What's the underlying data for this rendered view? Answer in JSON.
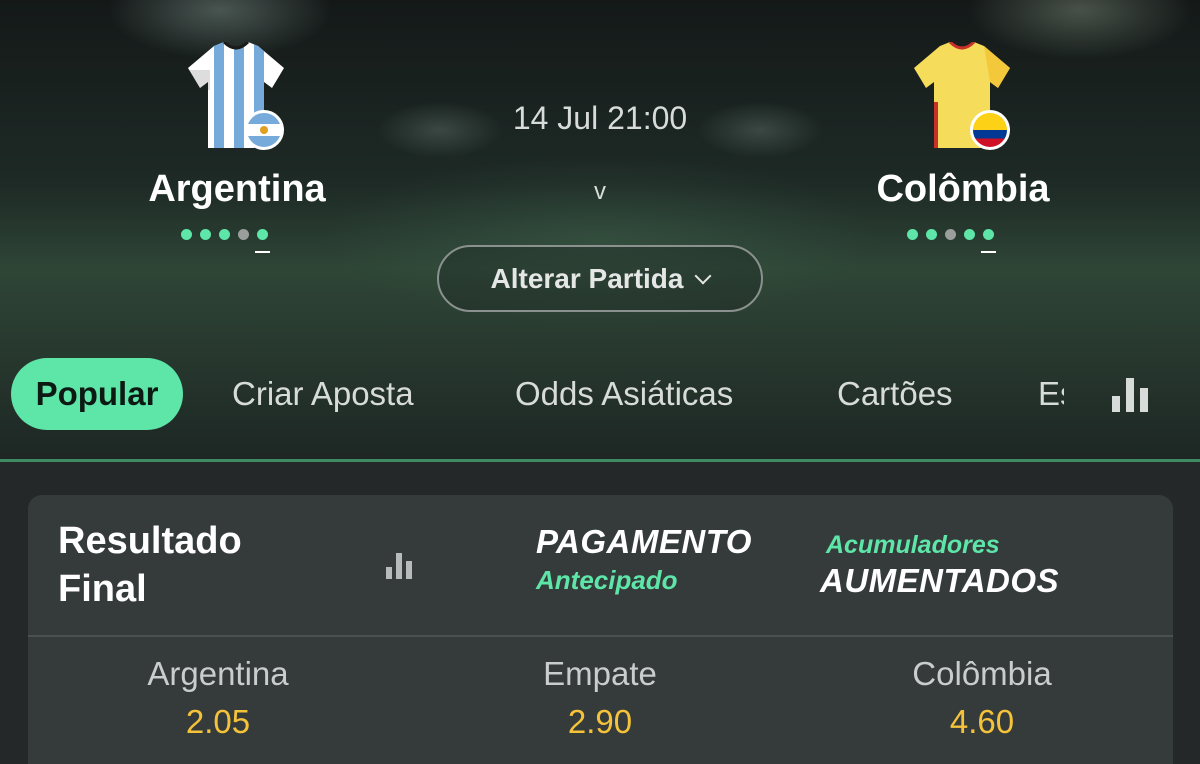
{
  "match": {
    "datetime": "14 Jul 21:00",
    "versus": "v",
    "home": {
      "name": "Argentina",
      "form": [
        "win",
        "win",
        "win",
        "neutral",
        "win"
      ]
    },
    "away": {
      "name": "Colômbia",
      "form": [
        "win",
        "win",
        "neutral",
        "win",
        "win"
      ]
    },
    "change_match_label": "Alterar Partida"
  },
  "tabs": [
    {
      "label": "Popular",
      "active": true
    },
    {
      "label": "Criar Aposta",
      "active": false
    },
    {
      "label": "Odds Asiáticas",
      "active": false
    },
    {
      "label": "Cartões",
      "active": false
    },
    {
      "label": "Es",
      "active": false
    }
  ],
  "market": {
    "title_line1": "Resultado",
    "title_line2": "Final",
    "promo_early_payout": {
      "line1": "PAGAMENTO",
      "line2": "Antecipado"
    },
    "promo_acca_boost": {
      "line1": "Acumuladores",
      "line2": "AUMENTADOS"
    },
    "outcomes": [
      {
        "name": "Argentina",
        "odds": "2.05"
      },
      {
        "name": "Empate",
        "odds": "2.90"
      },
      {
        "name": "Colômbia",
        "odds": "4.60"
      }
    ]
  },
  "colors": {
    "accent": "#5ee5a8",
    "odds": "#f5c33a",
    "card": "#353a3a",
    "background": "#242828",
    "home_jersey_stripe": "#75aadb",
    "away_jersey": "#f5dc5a"
  },
  "icons": [
    "home-jersey-icon",
    "argentina-flag-icon",
    "away-jersey-icon",
    "colombia-flag-icon",
    "chevron-down-icon",
    "stats-icon"
  ]
}
